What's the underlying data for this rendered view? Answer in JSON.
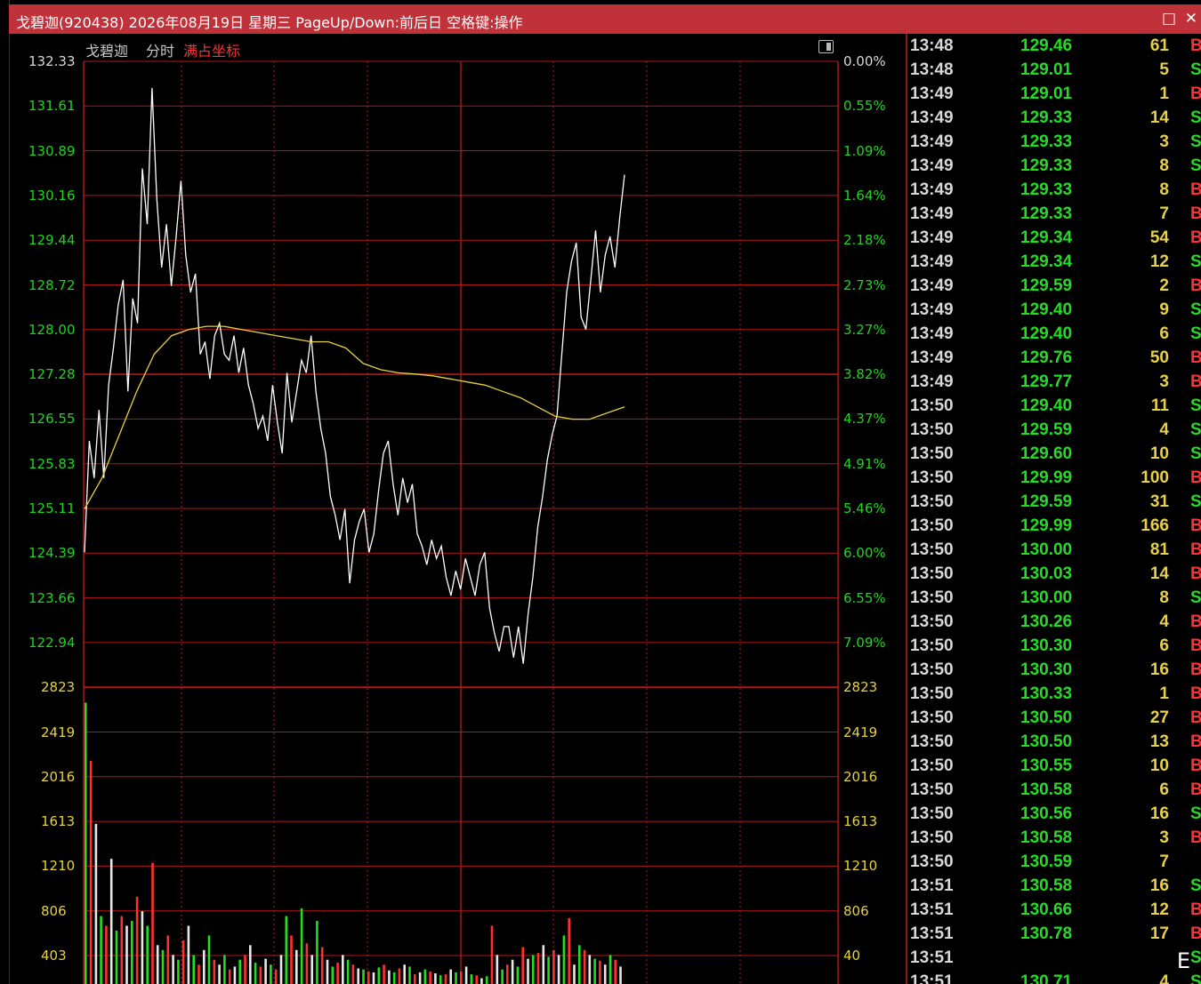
{
  "window": {
    "title": "戈碧迦(920438) 2026年08月19日 星期三 PageUp/Down:前后日 空格键:操作",
    "controls": [
      "□",
      "✕"
    ]
  },
  "chart_header": {
    "name": "戈碧迦",
    "mode": "分时",
    "scale_mode": "满占坐标"
  },
  "colors": {
    "title_bar": "#c0313a",
    "grid": "#b01818",
    "price_line": "#ffffff",
    "avg_line": "#e6d23c",
    "axis_text": "#1fd41f",
    "pct_text": "#1fd41f",
    "vol_axis_text": "#e6d23c",
    "buy": "#ff3030",
    "sell": "#22dd22"
  },
  "chart_data": {
    "type": "line",
    "title": "",
    "price_axis_left": [
      "132.33",
      "131.61",
      "130.89",
      "130.16",
      "129.44",
      "128.72",
      "128.00",
      "127.28",
      "126.55",
      "125.83",
      "125.11",
      "124.39",
      "123.66",
      "122.94"
    ],
    "pct_axis_right": [
      "0.00%",
      "0.55%",
      "1.09%",
      "1.64%",
      "2.18%",
      "2.73%",
      "3.27%",
      "3.82%",
      "4.37%",
      "4.91%",
      "5.46%",
      "6.00%",
      "6.55%",
      "7.09%"
    ],
    "volume_axis_left": [
      "2823",
      "2419",
      "2016",
      "1613",
      "1210",
      "806",
      "403"
    ],
    "volume_axis_right": [
      "2823",
      "2419",
      "2016",
      "1613",
      "1210",
      "806",
      "40"
    ],
    "ylim_price": [
      122.22,
      132.33
    ],
    "ylim_volume": [
      0,
      3226
    ],
    "series": [
      {
        "type": "line",
        "values": [
          124.4,
          126.2,
          125.6,
          126.7,
          125.6,
          127.1,
          127.7,
          128.4,
          128.8,
          127.0,
          128.5,
          128.1,
          130.6,
          129.7,
          131.9,
          130.1,
          129.0,
          129.7,
          128.7,
          129.5,
          130.4,
          129.2,
          128.6,
          128.9,
          127.6,
          127.8,
          127.2,
          127.9,
          128.1,
          127.6,
          127.5,
          127.9,
          127.3,
          127.7,
          127.1,
          126.8,
          126.4,
          126.6,
          126.2,
          127.1,
          126.5,
          126.0,
          127.3,
          126.5,
          127.0,
          127.5,
          127.3,
          127.9,
          127.0,
          126.4,
          126.0,
          125.3,
          125.0,
          124.6,
          125.1,
          123.9,
          124.6,
          124.9,
          125.1,
          124.4,
          124.7,
          125.4,
          126.0,
          126.2,
          125.5,
          125.0,
          125.6,
          125.2,
          125.5,
          124.7,
          124.5,
          124.2,
          124.6,
          124.3,
          124.5,
          124.0,
          123.7,
          124.1,
          123.8,
          124.3,
          124.0,
          123.7,
          124.2,
          124.4,
          123.5,
          123.1,
          122.8,
          123.2,
          123.2,
          122.7,
          123.2,
          122.6,
          123.4,
          124.0,
          124.8,
          125.3,
          125.9,
          126.3,
          126.6,
          127.6,
          128.6,
          129.1,
          129.4,
          128.2,
          128.0,
          128.8,
          129.6,
          128.6,
          129.2,
          129.5,
          129.0,
          129.8,
          130.5
        ],
        "note": ""
      },
      {
        "type": "line",
        "values": [
          125.1,
          125.6,
          126.3,
          127.0,
          127.6,
          127.9,
          128.0,
          128.05,
          128.05,
          128.0,
          127.95,
          127.9,
          127.85,
          127.8,
          127.8,
          127.7,
          127.45,
          127.35,
          127.3,
          127.28,
          127.25,
          127.2,
          127.15,
          127.1,
          127.0,
          126.9,
          126.75,
          126.6,
          126.55,
          126.55,
          126.65,
          126.75
        ]
      }
    ],
    "volume_bars_note": "white/red/green bars near bottom, mostly below 800, max about 2900 at open"
  },
  "trades": [
    {
      "time": "13:48",
      "price": "129.46",
      "vol": "61",
      "side": "B"
    },
    {
      "time": "13:48",
      "price": "129.01",
      "vol": "5",
      "side": "S"
    },
    {
      "time": "13:49",
      "price": "129.01",
      "vol": "1",
      "side": "B"
    },
    {
      "time": "13:49",
      "price": "129.33",
      "vol": "14",
      "side": "S"
    },
    {
      "time": "13:49",
      "price": "129.33",
      "vol": "3",
      "side": "S"
    },
    {
      "time": "13:49",
      "price": "129.33",
      "vol": "8",
      "side": "S"
    },
    {
      "time": "13:49",
      "price": "129.33",
      "vol": "8",
      "side": "B"
    },
    {
      "time": "13:49",
      "price": "129.33",
      "vol": "7",
      "side": "B"
    },
    {
      "time": "13:49",
      "price": "129.34",
      "vol": "54",
      "side": "B"
    },
    {
      "time": "13:49",
      "price": "129.34",
      "vol": "12",
      "side": "S"
    },
    {
      "time": "13:49",
      "price": "129.59",
      "vol": "2",
      "side": "B"
    },
    {
      "time": "13:49",
      "price": "129.40",
      "vol": "9",
      "side": "S"
    },
    {
      "time": "13:49",
      "price": "129.40",
      "vol": "6",
      "side": "S"
    },
    {
      "time": "13:49",
      "price": "129.76",
      "vol": "50",
      "side": "B"
    },
    {
      "time": "13:49",
      "price": "129.77",
      "vol": "3",
      "side": "B"
    },
    {
      "time": "13:50",
      "price": "129.40",
      "vol": "11",
      "side": "S"
    },
    {
      "time": "13:50",
      "price": "129.59",
      "vol": "4",
      "side": "S"
    },
    {
      "time": "13:50",
      "price": "129.60",
      "vol": "10",
      "side": "S"
    },
    {
      "time": "13:50",
      "price": "129.99",
      "vol": "100",
      "side": "B"
    },
    {
      "time": "13:50",
      "price": "129.59",
      "vol": "31",
      "side": "S"
    },
    {
      "time": "13:50",
      "price": "129.99",
      "vol": "166",
      "side": "B"
    },
    {
      "time": "13:50",
      "price": "130.00",
      "vol": "81",
      "side": "B"
    },
    {
      "time": "13:50",
      "price": "130.03",
      "vol": "14",
      "side": "B"
    },
    {
      "time": "13:50",
      "price": "130.00",
      "vol": "8",
      "side": "S"
    },
    {
      "time": "13:50",
      "price": "130.26",
      "vol": "4",
      "side": "B"
    },
    {
      "time": "13:50",
      "price": "130.30",
      "vol": "6",
      "side": "B"
    },
    {
      "time": "13:50",
      "price": "130.30",
      "vol": "16",
      "side": "B"
    },
    {
      "time": "13:50",
      "price": "130.33",
      "vol": "1",
      "side": "B"
    },
    {
      "time": "13:50",
      "price": "130.50",
      "vol": "27",
      "side": "B"
    },
    {
      "time": "13:50",
      "price": "130.50",
      "vol": "13",
      "side": "B"
    },
    {
      "time": "13:50",
      "price": "130.55",
      "vol": "10",
      "side": "B"
    },
    {
      "time": "13:50",
      "price": "130.58",
      "vol": "6",
      "side": "B"
    },
    {
      "time": "13:50",
      "price": "130.56",
      "vol": "16",
      "side": "S"
    },
    {
      "time": "13:50",
      "price": "130.58",
      "vol": "3",
      "side": "B"
    },
    {
      "time": "13:50",
      "price": "130.59",
      "vol": "7",
      "side": ""
    },
    {
      "time": "13:51",
      "price": "130.58",
      "vol": "16",
      "side": "S"
    },
    {
      "time": "13:51",
      "price": "130.66",
      "vol": "12",
      "side": "B"
    },
    {
      "time": "13:51",
      "price": "130.78",
      "vol": "17",
      "side": "B"
    },
    {
      "time": "13:51",
      "price": "",
      "vol": "",
      "side": "S"
    },
    {
      "time": "13:51",
      "price": "130.71",
      "vol": "4",
      "side": "S"
    }
  ]
}
